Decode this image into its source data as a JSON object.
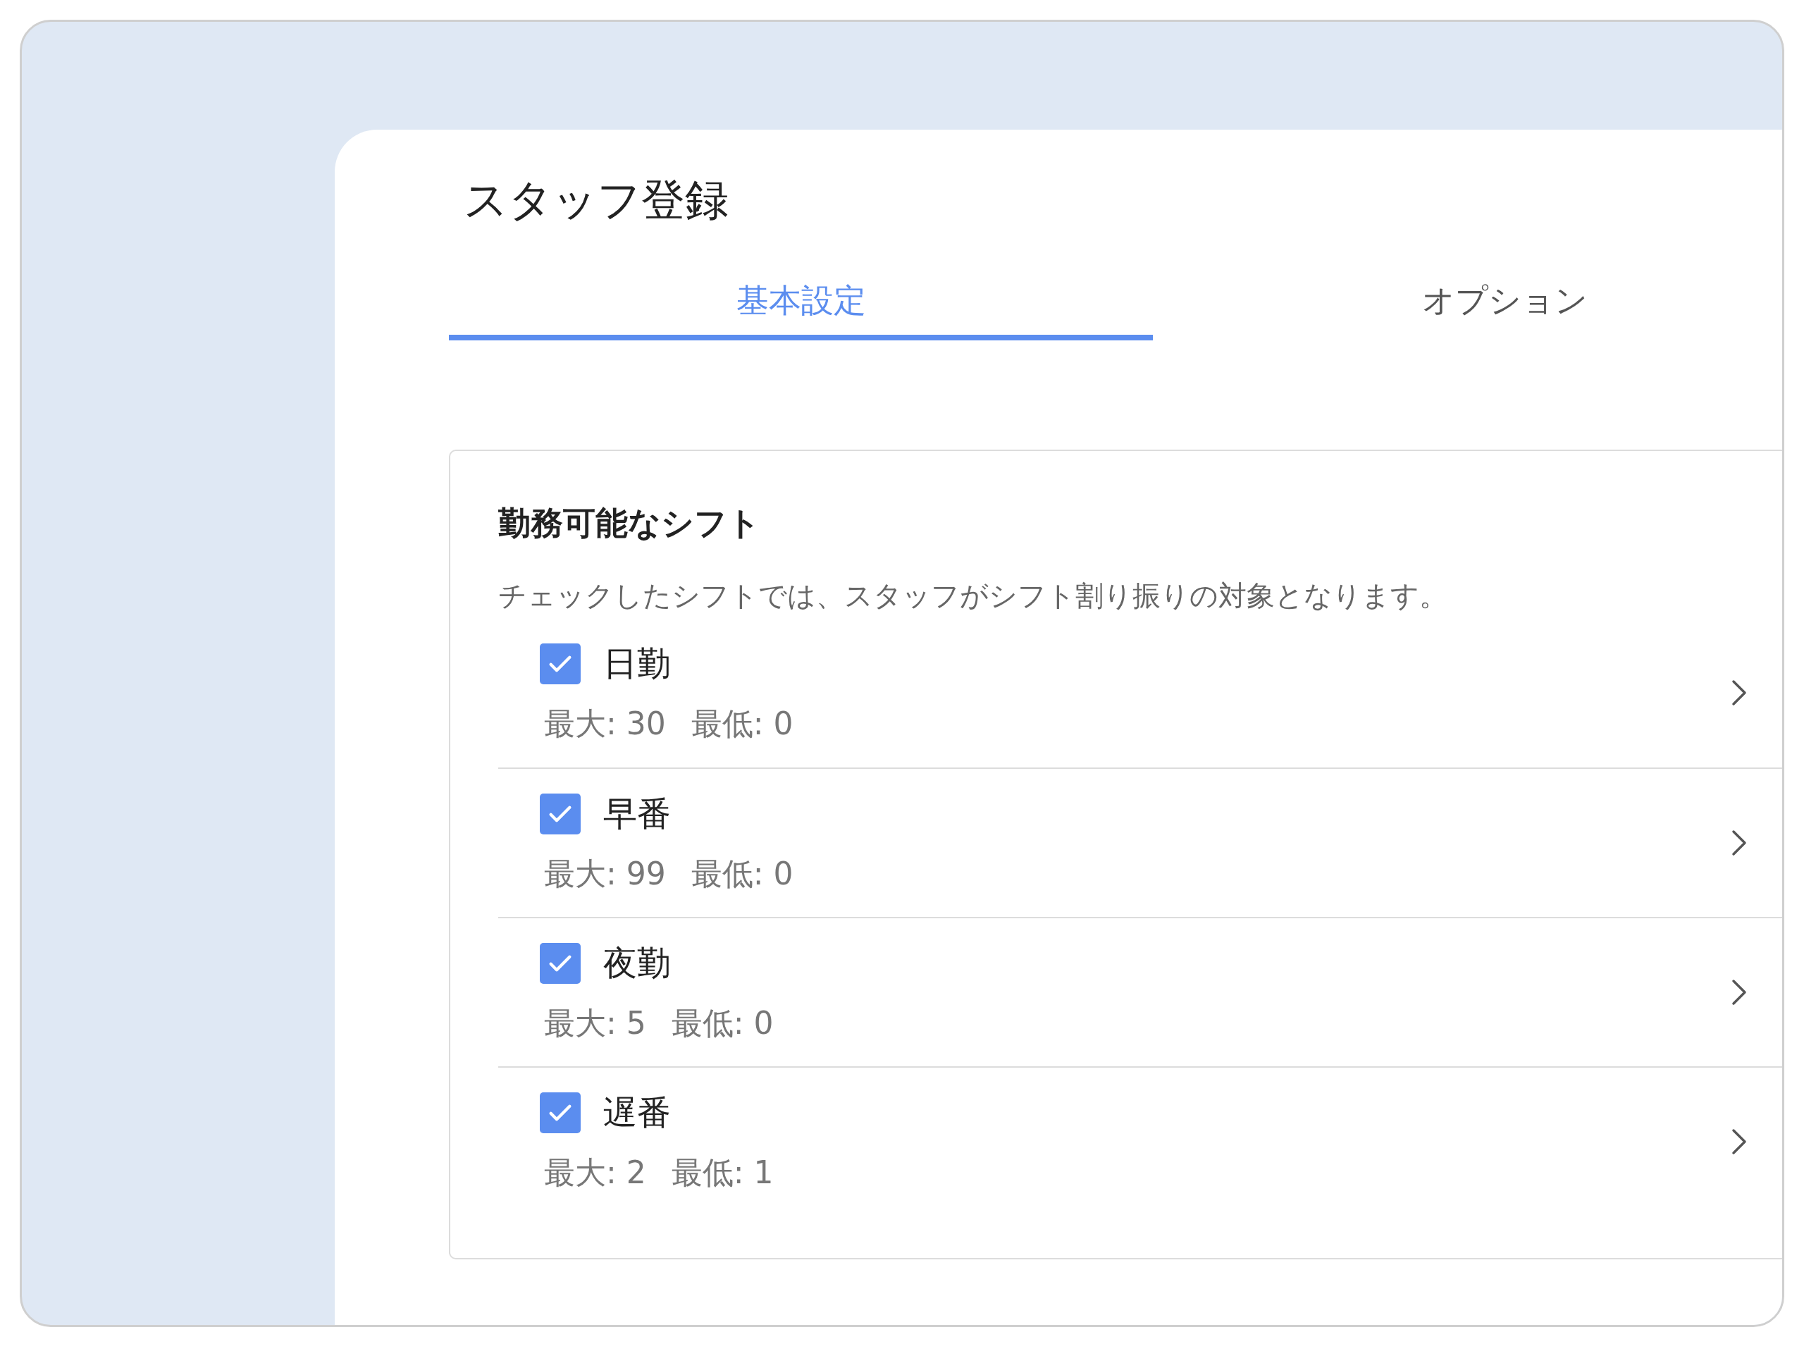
{
  "title": "スタッフ登録",
  "tabs": [
    {
      "label": "基本設定",
      "selected": true
    },
    {
      "label": "オプション",
      "selected": false
    }
  ],
  "section": {
    "heading": "勤務可能なシフト",
    "description": "チェックしたシフトでは、スタッフがシフト割り振りの対象となります。",
    "shifts": [
      {
        "name": "日勤",
        "checked": true,
        "max": "最大: 30",
        "min": "最低: 0"
      },
      {
        "name": "早番",
        "checked": true,
        "max": "最大: 99",
        "min": "最低: 0"
      },
      {
        "name": "夜勤",
        "checked": true,
        "max": "最大: 5",
        "min": "最低: 0"
      },
      {
        "name": "遅番",
        "checked": true,
        "max": "最大: 2",
        "min": "最低: 1"
      }
    ]
  }
}
